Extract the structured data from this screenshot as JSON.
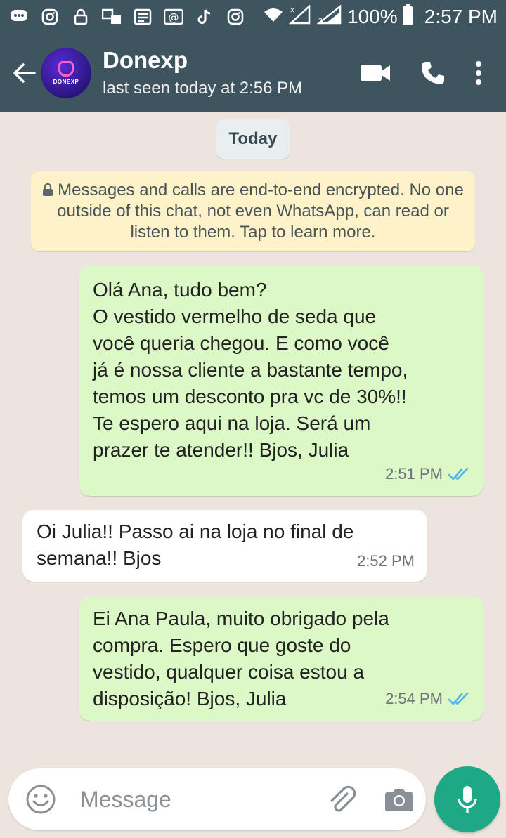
{
  "status_bar": {
    "battery": "100%",
    "time": "2:57 PM",
    "icons": [
      "messages-icon",
      "instagram-icon",
      "lock-icon",
      "translate-icon",
      "news-icon",
      "email-icon",
      "tiktok-icon",
      "instagram-icon",
      "wifi-icon",
      "signal-icon",
      "signal-icon",
      "battery-icon"
    ]
  },
  "header": {
    "contact_name": "Donexp",
    "avatar_text": "DONEXP",
    "last_seen": "last seen today at 2:56 PM",
    "accent": "#3e5560"
  },
  "chat": {
    "date_chip": "Today",
    "encryption_notice": "Messages and calls are end-to-end encrypted. No one outside of this chat, not even WhatsApp, can read or listen to them. Tap to learn more.",
    "messages": [
      {
        "direction": "outgoing",
        "text": "Olá Ana, tudo bem?\nO vestido vermelho de seda que\nvocê queria chegou. E como você\njá é nossa cliente a bastante tempo,\ntemos um desconto pra vc de 30%!!\nTe espero aqui na loja. Será um\nprazer te atender!! Bjos, Julia",
        "time": "2:51 PM",
        "status": "read"
      },
      {
        "direction": "incoming",
        "text": "Oi Julia!! Passo ai na loja no final de\nsemana!! Bjos",
        "time": "2:52 PM"
      },
      {
        "direction": "outgoing",
        "text": "Ei Ana Paula, muito obrigado pela\ncompra. Espero que goste do\nvestido, qualquer coisa estou a\ndisposição! Bjos, Julia",
        "time": "2:54 PM",
        "status": "read"
      }
    ]
  },
  "composer": {
    "placeholder": "Message"
  },
  "colors": {
    "outgoing_bubble": "#dcf8c6",
    "incoming_bubble": "#ffffff",
    "read_ticks": "#4fb6ec",
    "mic_button": "#1fa886"
  }
}
